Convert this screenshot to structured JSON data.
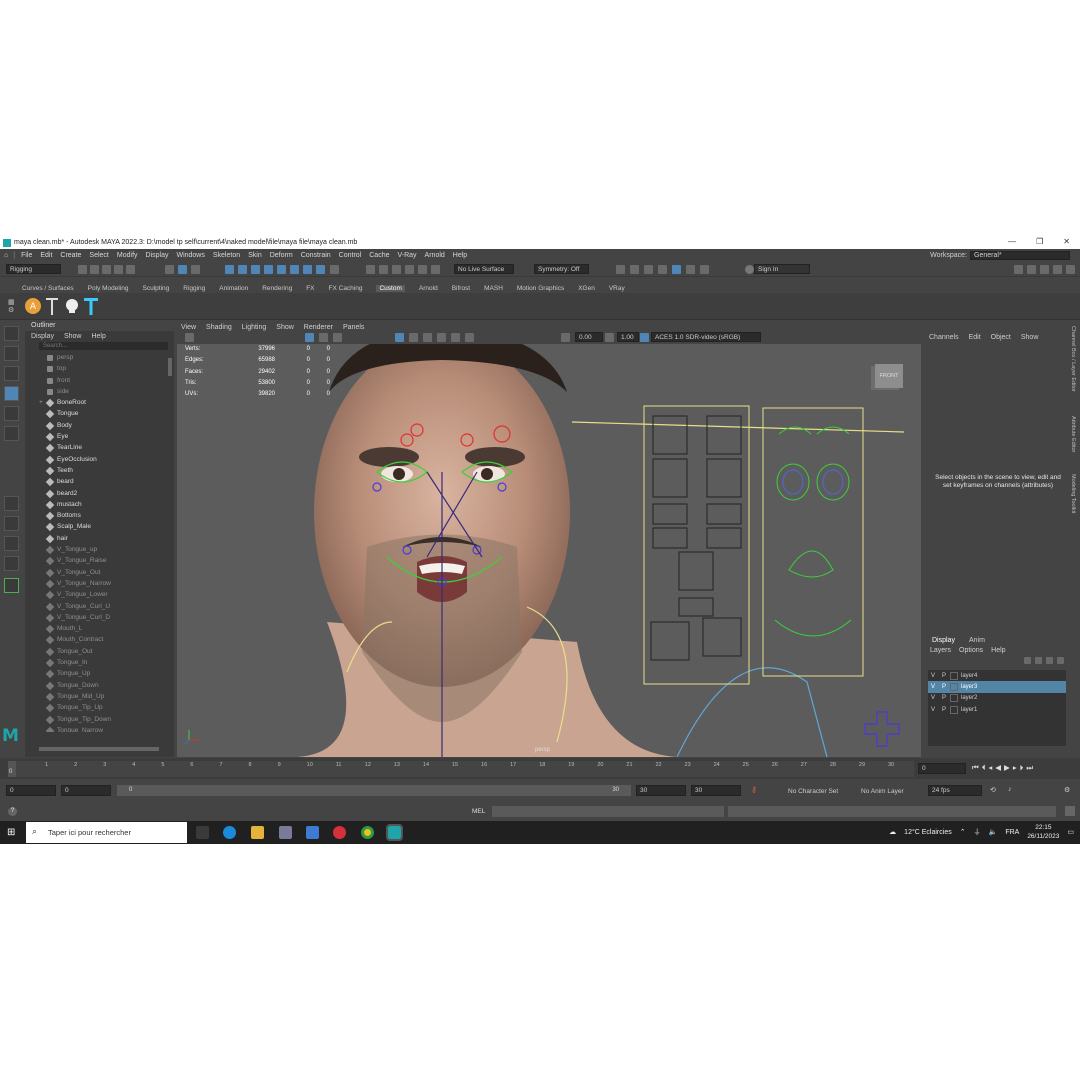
{
  "titlebar": {
    "title": "maya clean.mb* - Autodesk MAYA 2022.3: D:\\model tp self\\current\\4\\naked model\\file\\maya file\\maya clean.mb",
    "min": "—",
    "max": "❐",
    "close": "✕"
  },
  "menubar": {
    "items": [
      "File",
      "Edit",
      "Create",
      "Select",
      "Modify",
      "Display",
      "Windows",
      "Skeleton",
      "Skin",
      "Deform",
      "Constrain",
      "Control",
      "Cache",
      "V-Ray",
      "Arnold",
      "Help"
    ],
    "workspace_label": "Workspace:",
    "workspace_value": "General*"
  },
  "statusline": {
    "menuset": "Rigging",
    "live_surface": "No Live Surface",
    "symmetry": "Symmetry: Off",
    "sign_in": "Sign In"
  },
  "shelf": {
    "tabs": [
      "Curves / Surfaces",
      "Poly Modeling",
      "Sculpting",
      "Rigging",
      "Animation",
      "Rendering",
      "FX",
      "FX Caching",
      "Custom",
      "Arnold",
      "Bifrost",
      "MASH",
      "Motion Graphics",
      "XGen",
      "VRay"
    ],
    "active_tab": "Custom"
  },
  "outliner": {
    "title": "Outliner",
    "menu": [
      "Display",
      "Show",
      "Help"
    ],
    "search_placeholder": "Search...",
    "items": [
      {
        "label": "persp",
        "dim": true,
        "cam": true
      },
      {
        "label": "top",
        "dim": true,
        "cam": true
      },
      {
        "label": "front",
        "dim": true,
        "cam": true
      },
      {
        "label": "side",
        "dim": true,
        "cam": true
      },
      {
        "label": "BoneRoot",
        "dim": false,
        "exp": "+"
      },
      {
        "label": "Tongue",
        "dim": false
      },
      {
        "label": "Body",
        "dim": false
      },
      {
        "label": "Eye",
        "dim": false
      },
      {
        "label": "TearLine",
        "dim": false
      },
      {
        "label": "EyeOcclusion",
        "dim": false
      },
      {
        "label": "Teeth",
        "dim": false
      },
      {
        "label": "beard",
        "dim": false
      },
      {
        "label": "beard2",
        "dim": false
      },
      {
        "label": "mustach",
        "dim": false
      },
      {
        "label": "Bottoms",
        "dim": false
      },
      {
        "label": "Scalp_Male",
        "dim": false
      },
      {
        "label": "hair",
        "dim": false
      },
      {
        "label": "V_Tongue_up",
        "dim": true
      },
      {
        "label": "V_Tongue_Raise",
        "dim": true
      },
      {
        "label": "V_Tongue_Out",
        "dim": true
      },
      {
        "label": "V_Tongue_Narrow",
        "dim": true
      },
      {
        "label": "V_Tongue_Lower",
        "dim": true
      },
      {
        "label": "V_Tongue_Curl_U",
        "dim": true
      },
      {
        "label": "V_Tongue_Curl_D",
        "dim": true
      },
      {
        "label": "Mouth_L",
        "dim": true
      },
      {
        "label": "Mouth_Contract",
        "dim": true
      },
      {
        "label": "Tongue_Out",
        "dim": true
      },
      {
        "label": "Tongue_In",
        "dim": true
      },
      {
        "label": "Tongue_Up",
        "dim": true
      },
      {
        "label": "Tongue_Down",
        "dim": true
      },
      {
        "label": "Tongue_Mid_Up",
        "dim": true
      },
      {
        "label": "Tongue_Tip_Up",
        "dim": true
      },
      {
        "label": "Tongue_Tip_Down",
        "dim": true
      },
      {
        "label": "Tongue_Narrow",
        "dim": true
      },
      {
        "label": "Tongue_Wide",
        "dim": true
      }
    ]
  },
  "viewport": {
    "menu": [
      "View",
      "Shading",
      "Lighting",
      "Show",
      "Renderer",
      "Panels"
    ],
    "exposure": "0.00",
    "gamma": "1.00",
    "colorspace": "ACES 1.0 SDR-video (sRGB)",
    "hud": [
      {
        "label": "Verts:",
        "a": "37996",
        "b": "0",
        "c": "0"
      },
      {
        "label": "Edges:",
        "a": "65988",
        "b": "0",
        "c": "0"
      },
      {
        "label": "Faces:",
        "a": "29402",
        "b": "0",
        "c": "0"
      },
      {
        "label": "Tris:",
        "a": "53800",
        "b": "0",
        "c": "0"
      },
      {
        "label": "UVs:",
        "a": "39820",
        "b": "0",
        "c": "0"
      }
    ],
    "viewcube_label": "FRONT",
    "camera_label": "persp"
  },
  "channelbox": {
    "menu": [
      "Channels",
      "Edit",
      "Object",
      "Show"
    ],
    "message": "Select objects in the scene to view, edit and set keyframes on channels (attributes)",
    "side_tabs": [
      "Channel Box / Layer Editor",
      "Attribute Editor",
      "Modeling Toolkit"
    ]
  },
  "layers": {
    "tabs": [
      "Display",
      "Anim"
    ],
    "menu": [
      "Layers",
      "Options",
      "Help"
    ],
    "rows": [
      {
        "v": "V",
        "p": "P",
        "name": "layer4",
        "selected": false
      },
      {
        "v": "V",
        "p": "P",
        "name": "layer3",
        "selected": true
      },
      {
        "v": "V",
        "p": "P",
        "name": "layer2",
        "selected": false
      },
      {
        "v": "V",
        "p": "P",
        "name": "layer1",
        "selected": false
      }
    ]
  },
  "timeline": {
    "ticks": [
      "0",
      "1",
      "2",
      "3",
      "4",
      "5",
      "6",
      "7",
      "8",
      "9",
      "10",
      "11",
      "12",
      "13",
      "14",
      "15",
      "16",
      "17",
      "18",
      "19",
      "20",
      "21",
      "22",
      "23",
      "24",
      "25",
      "26",
      "27",
      "28",
      "29",
      "30"
    ],
    "current_frame_marker": "0",
    "current_frame_field": "0"
  },
  "range": {
    "start": "0",
    "anim_start": "0",
    "range_start": "0",
    "range_end": "30",
    "anim_end": "30",
    "end": "30",
    "character_set": "No Character Set",
    "anim_layer": "No Anim Layer",
    "fps": "24 fps"
  },
  "cmdline": {
    "lang": "MEL",
    "help": "?"
  },
  "taskbar": {
    "search_placeholder": "Taper ici pour rechercher",
    "weather": "12°C  Eclaircies",
    "lang": "FRA",
    "time": "22:15",
    "date": "26/11/2023"
  }
}
